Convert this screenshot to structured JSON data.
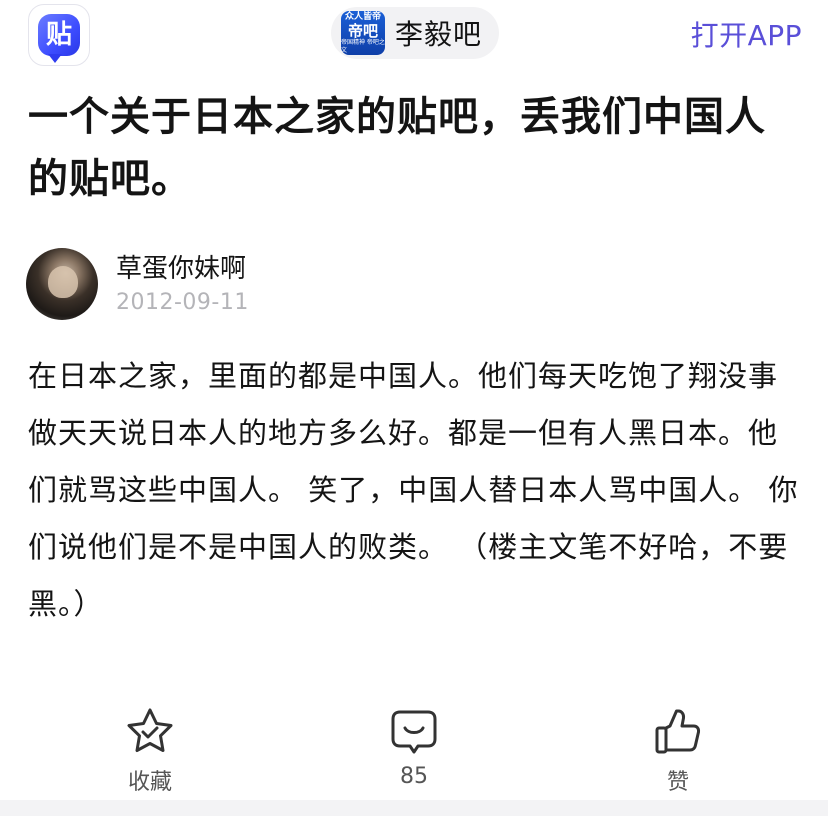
{
  "header": {
    "app_logo_text": "贴",
    "forum": {
      "avatar_line1": "众人皆帝",
      "avatar_line2": "帝吧",
      "avatar_line3": "帝国精神 帝吧之文",
      "name": "李毅吧"
    },
    "open_app_label": "打开APP"
  },
  "post": {
    "title": "一个关于日本之家的贴吧，丢我们中国人的贴吧。",
    "author": {
      "name": "草蛋你妹啊",
      "date": "2012-09-11"
    },
    "body": "在日本之家，里面的都是中国人。他们每天吃饱了翔没事做天天说日本人的地方多么好。都是一但有人黑日本。他们就骂这些中国人。 笑了，中国人替日本人骂中国人。 你们说他们是不是中国人的败类。 （楼主文笔不好哈，不要黑。）"
  },
  "actions": {
    "collect_label": "收藏",
    "comment_count": "85",
    "like_label": "赞"
  },
  "colors": {
    "accent": "#5a4fd8",
    "text": "#141414",
    "muted": "#b4b4b8",
    "icon": "#333333"
  },
  "icons": [
    "tieba-logo-icon",
    "star-check-icon",
    "comment-bubble-icon",
    "thumbs-up-icon"
  ]
}
